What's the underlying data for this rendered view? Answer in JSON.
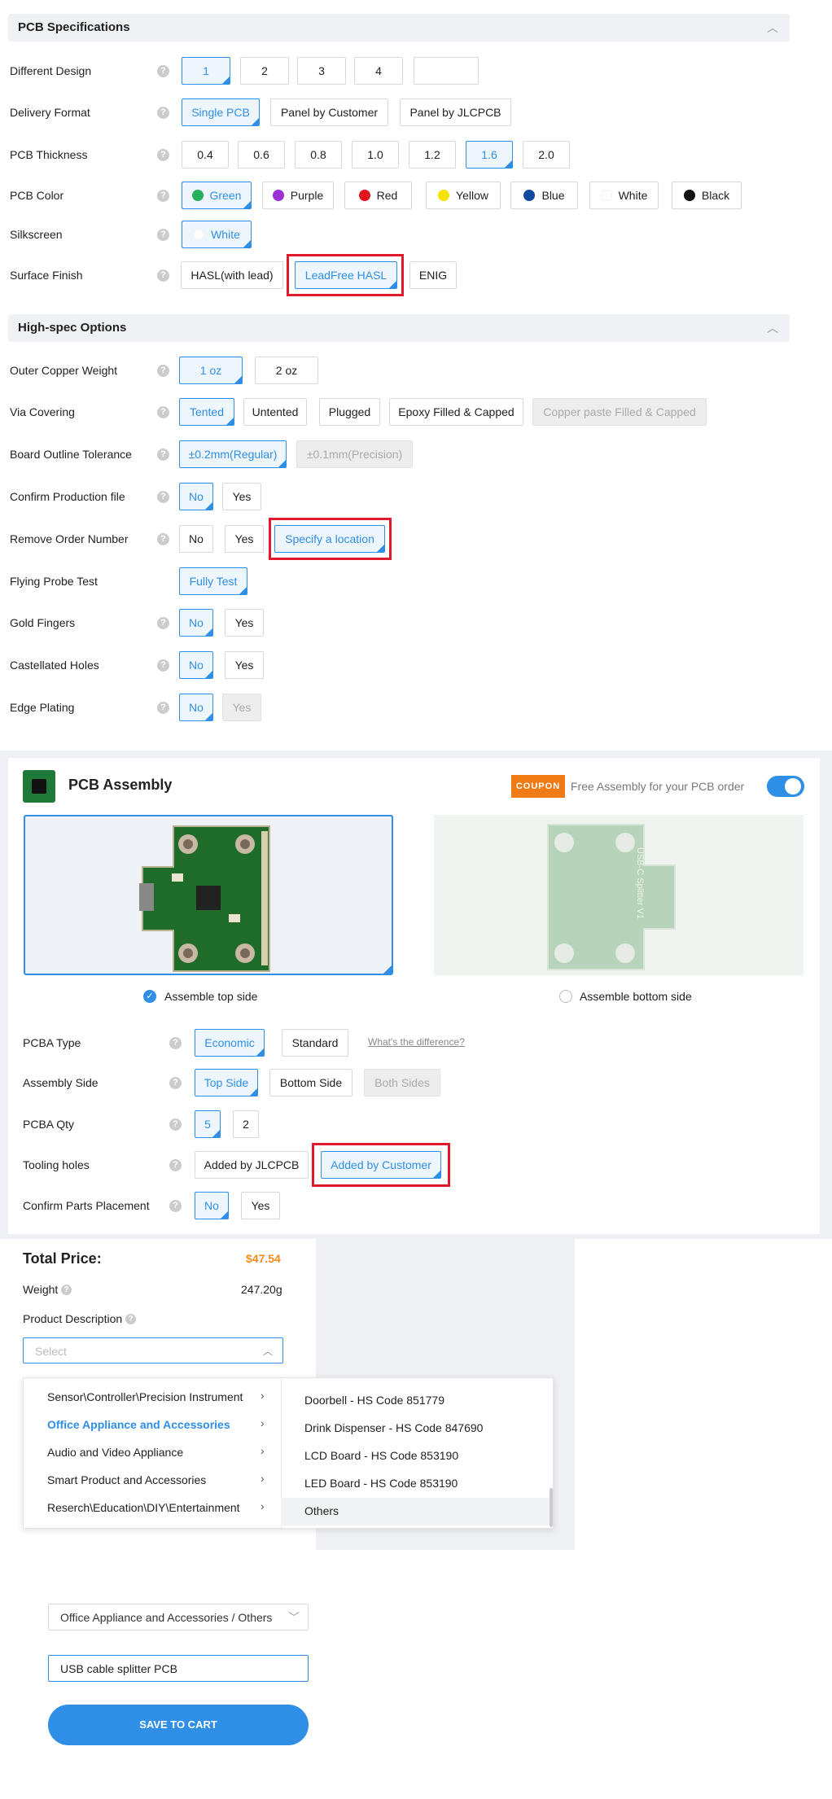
{
  "pcb_specs": {
    "title": "PCB Specifications",
    "help": "?",
    "different_design": {
      "label": "Different Design",
      "options": [
        "1",
        "2",
        "3",
        "4",
        ""
      ]
    },
    "delivery_format": {
      "label": "Delivery Format",
      "options": [
        "Single PCB",
        "Panel by Customer",
        "Panel by JLCPCB"
      ]
    },
    "thickness": {
      "label": "PCB Thickness",
      "options": [
        "0.4",
        "0.6",
        "0.8",
        "1.0",
        "1.2",
        "1.6",
        "2.0"
      ]
    },
    "color": {
      "label": "PCB Color",
      "options": [
        {
          "name": "Green",
          "hex": "#27ae60"
        },
        {
          "name": "Purple",
          "hex": "#9b2fd6"
        },
        {
          "name": "Red",
          "hex": "#e0141e"
        },
        {
          "name": "Yellow",
          "hex": "#f5e400"
        },
        {
          "name": "Blue",
          "hex": "#0f4aa0"
        },
        {
          "name": "White",
          "hex": "#ffffff"
        },
        {
          "name": "Black",
          "hex": "#111111"
        }
      ]
    },
    "silkscreen": {
      "label": "Silkscreen",
      "options": [
        "White"
      ]
    },
    "surface_finish": {
      "label": "Surface Finish",
      "options": [
        "HASL(with lead)",
        "LeadFree HASL",
        "ENIG"
      ]
    }
  },
  "high_spec": {
    "title": "High-spec Options",
    "outer_copper": {
      "label": "Outer Copper Weight",
      "options": [
        "1 oz",
        "2 oz"
      ]
    },
    "via_covering": {
      "label": "Via Covering",
      "options": [
        "Tented",
        "Untented",
        "Plugged",
        "Epoxy Filled & Capped",
        "Copper paste Filled & Capped"
      ]
    },
    "outline_tol": {
      "label": "Board Outline Tolerance",
      "options": [
        "±0.2mm(Regular)",
        "±0.1mm(Precision)"
      ]
    },
    "confirm_file": {
      "label": "Confirm Production file",
      "options": [
        "No",
        "Yes"
      ]
    },
    "remove_order": {
      "label": "Remove Order Number",
      "options": [
        "No",
        "Yes",
        "Specify a location"
      ]
    },
    "flying_probe": {
      "label": "Flying Probe Test",
      "options": [
        "Fully Test"
      ]
    },
    "gold_fingers": {
      "label": "Gold Fingers",
      "options": [
        "No",
        "Yes"
      ]
    },
    "castellated": {
      "label": "Castellated Holes",
      "options": [
        "No",
        "Yes"
      ]
    },
    "edge_plating": {
      "label": "Edge Plating",
      "options": [
        "No",
        "Yes"
      ]
    }
  },
  "assembly": {
    "title": "PCB Assembly",
    "coupon": "COUPON",
    "promo": "Free Assembly for your PCB order",
    "toggle_on": true,
    "top_side": "Assemble top side",
    "bottom_side": "Assemble bottom side",
    "pcba_type": {
      "label": "PCBA Type",
      "options": [
        "Economic",
        "Standard"
      ],
      "link": "What's the difference?"
    },
    "assembly_side": {
      "label": "Assembly Side",
      "options": [
        "Top Side",
        "Bottom Side",
        "Both Sides"
      ]
    },
    "pcba_qty": {
      "label": "PCBA Qty",
      "options": [
        "5",
        "2"
      ]
    },
    "tooling": {
      "label": "Tooling holes",
      "options": [
        "Added by JLCPCB",
        "Added by Customer"
      ]
    },
    "confirm_parts": {
      "label": "Confirm Parts Placement",
      "options": [
        "No",
        "Yes"
      ]
    },
    "board_text_bottom": "USB-C Splitter V1"
  },
  "summary": {
    "total_label": "Total Price:",
    "total_value": "$47.54",
    "weight_label": "Weight",
    "weight_value": "247.20g",
    "desc_label": "Product Description",
    "select_placeholder": "Select"
  },
  "menu": {
    "categories": [
      "Sensor\\Controller\\Precision Instrument",
      "Office Appliance and Accessories",
      "Audio and Video Appliance",
      "Smart Product and Accessories",
      "Reserch\\Education\\DIY\\Entertainment"
    ],
    "sub_items": [
      "Doorbell - HS Code 851779",
      "Drink Dispenser - HS Code 847690",
      "LCD Board - HS Code 853190",
      "LED Board - HS Code 853190",
      "Others"
    ]
  },
  "bottom": {
    "selected_value": "Office Appliance and Accessories / Others",
    "text_value": "USB cable splitter PCB",
    "cart_button": "SAVE TO CART"
  },
  "colors": {
    "accent": "#2f8ee6",
    "price": "#f28b1a",
    "highlight": "#e11a2b"
  }
}
